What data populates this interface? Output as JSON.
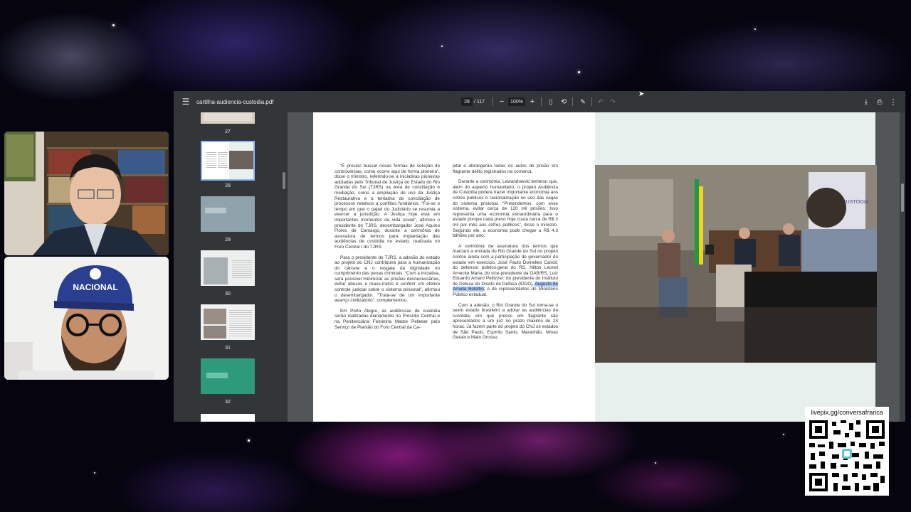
{
  "viewer": {
    "file_title": "cartilha-audiencia-custodia.pdf",
    "page_current": "28",
    "page_total": "/ 117",
    "zoom": "100%",
    "icons": {
      "menu": "menu-icon",
      "zoom_out": "minus-icon",
      "zoom_in": "plus-icon",
      "fit": "fit-page-icon",
      "rotate": "rotate-icon",
      "annotate": "annotate-icon",
      "undo": "undo-icon",
      "redo": "redo-icon",
      "download": "download-icon",
      "print": "print-icon",
      "more": "more-vert-icon"
    }
  },
  "sidebar": {
    "thumbnails": [
      {
        "page": "27"
      },
      {
        "page": "28",
        "selected": true
      },
      {
        "page": "29"
      },
      {
        "page": "30"
      },
      {
        "page": "31"
      },
      {
        "page": "32"
      }
    ]
  },
  "document": {
    "left_column": [
      "“É preciso buscar novas formas de solução de controvérsias, como ocorre aqui de forma pioneira”, disse o ministro, referindo-se a iniciativas pioneiras adotadas pelo Tribunal de Justiça do Estado do Rio Grande do Sul (TJRS) na área de conciliação e mediação, como a ampliação do uso da Justiça Restaurativa e a tentativa de conciliação de processos relativos a conflitos fundiários. “Foi-se o tempo em que o papel do Judiciário se resumia a exercer a jurisdição. A Justiça hoje está em importantes momentos da vida social”, afirmou o presidente do TJRS, desembargador José Aquino Flores de Camargo, durante a cerimônia de assinatura de termos para implantação das audiências de custódia no estado, realizada no Foro Central I do TJRS.",
      "Para o presidente do TJRS, a adesão do estado ao projeto do CNJ contribuirá para a humanização do cárcere e o resgate da dignidade no cumprimento das penas criminais. “Com a iniciativa, será possível minimizar as prisões desnecessárias, evitar abusos e maus-tratos e conferir um efetivo controle judicial sobre o sistema prisional”, afirmou o desembargador. “Trata-se de um importante avanço civilizatório”, complementou.",
      "Em Porto Alegre, as audiências de custódia serão realizadas diariamente no Presídio Central e na Penitenciária Feminina Madre Pelletier pelo Serviço de Plantão do Foro Central da Ca-"
    ],
    "right_column": [
      "pital e abrangerão todos os autos de prisão em flagrante delito registrados na comarca.",
      "Durante a cerimônia, Lewandowski lembrou que, além do aspecto humanitário, o projeto Audiência de Custódia poderá trazer importante economia aos cofres públicos e racionalização no uso das vagas do sistema prisional. “Pretendemos, com esse sistema, evitar cerca de 120 mil prisões. Isso representa uma economia extraordinária para o estado porque cada preso hoje custa cerca de R$ 3 mil por mês aos cofres públicos”, disse o ministro. Segundo ele, a economia pode chegar a R$ 4,3 bilhões por ano.",
      "A cerimônia de assinatura dos termos que marcam a entrada do Rio Grande do Sul no projeto contou ainda com a participação do governador do estado em exercício, José Paulo Domelles Cairoli; do defensor público-geral do RS, Nilton Leonel Arnecke Maria; do vice-presidente da OAB/RS, Luiz Eduardo Amaro Pellizzer; do presidente do Instituto de Defesa do Direito de Defesa (IDDD),",
      "Augusto de Arruda Botelho",
      "; e de representantes do Ministério Público estadual.",
      "Com a adesão, o Rio Grande do Sul torna-se o sexto estado brasileiro a adotar as audiências de custódia, em que presos em flagrante são apresentados a um juiz no prazo máximo de 24 horas. Já fazem parte do projeto do CNJ os estados de São Paulo, Espírito Santo, Maranhão, Minas Gerais e Mato Grosso."
    ],
    "photo_banner": "AUDIÊNCIA DE CUSTÓDIA"
  },
  "webcams": {
    "bottom_cap_text": "NACIONAL"
  },
  "qr": {
    "label": "livepix.gg/conversafranca"
  }
}
